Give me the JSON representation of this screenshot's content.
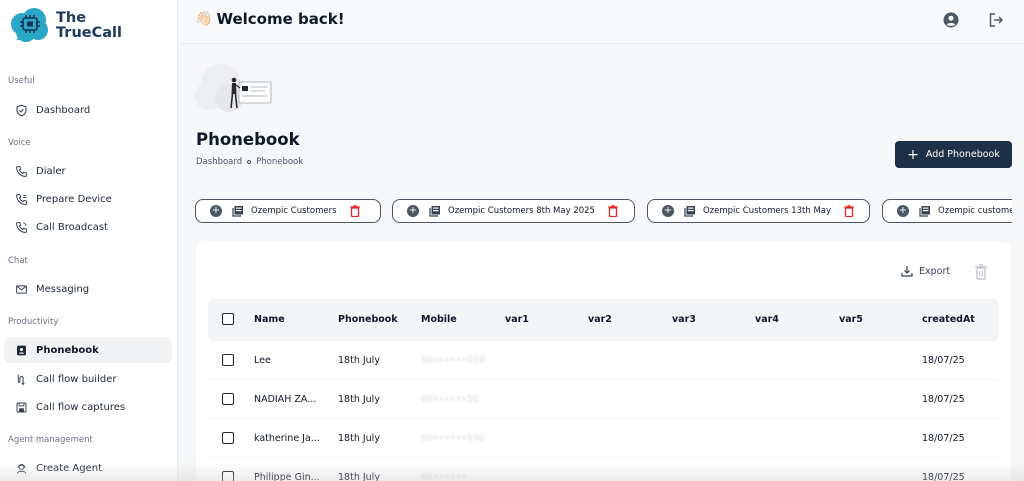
{
  "app": {
    "name_line1": "The",
    "name_line2": "TrueCall"
  },
  "sidebar": {
    "sections": [
      {
        "title": "Useful",
        "items": [
          {
            "label": "Dashboard",
            "icon": "shield-check-icon"
          }
        ]
      },
      {
        "title": "Voice",
        "items": [
          {
            "label": "Dialer",
            "icon": "phone-icon"
          },
          {
            "label": "Prepare Device",
            "icon": "phone-settings-icon"
          },
          {
            "label": "Call Broadcast",
            "icon": "phone-broadcast-icon"
          }
        ]
      },
      {
        "title": "Chat",
        "items": [
          {
            "label": "Messaging",
            "icon": "mail-icon"
          }
        ]
      },
      {
        "title": "Productivity",
        "items": [
          {
            "label": "Phonebook",
            "icon": "contact-book-icon",
            "active": true
          },
          {
            "label": "Call flow builder",
            "icon": "flow-icon"
          },
          {
            "label": "Call flow captures",
            "icon": "save-icon"
          }
        ]
      },
      {
        "title": "Agent management",
        "items": [
          {
            "label": "Create Agent",
            "icon": "agent-icon"
          }
        ]
      }
    ]
  },
  "header": {
    "welcome": "Welcome back!",
    "wave_emoji": "👋🏻"
  },
  "page": {
    "title": "Phonebook",
    "breadcrumb": [
      "Dashboard",
      "Phonebook"
    ],
    "add_button": "Add Phonebook"
  },
  "phonebooks": [
    "Ozempic Customers",
    "Ozempic Customers 8th May 2025",
    "Ozempic Customers 13th May",
    "Ozempic customer"
  ],
  "table": {
    "export_label": "Export",
    "columns": [
      "Name",
      "Phonebook",
      "Mobile",
      "var1",
      "var2",
      "var3",
      "var4",
      "var5",
      "createdAt"
    ],
    "rows": [
      {
        "name": "Lee",
        "phonebook": "18th July",
        "mobile": "60••••••019",
        "createdAt": "18/07/25"
      },
      {
        "name": "NADIAH ZA...",
        "phonebook": "18th July",
        "mobile": "60••••••50",
        "createdAt": "18/07/25"
      },
      {
        "name": "katherine Ja...",
        "phonebook": "18th July",
        "mobile": "60••••••930",
        "createdAt": "18/07/25"
      },
      {
        "name": "Philippe Gin...",
        "phonebook": "18th July",
        "mobile": "65••••••",
        "createdAt": "18/07/25"
      }
    ]
  },
  "colors": {
    "primary": "#1e3045",
    "danger": "#e02424",
    "logo": "#2aa6c7"
  }
}
